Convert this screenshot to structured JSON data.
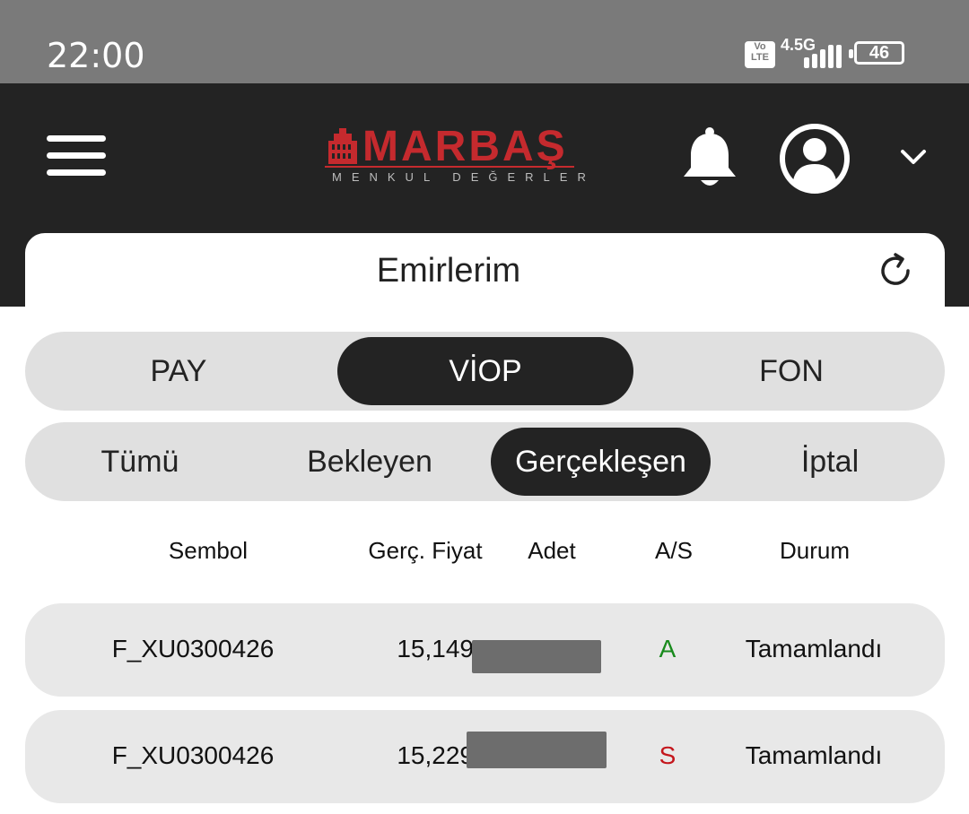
{
  "status_bar": {
    "time": "22:00",
    "volte": [
      "Vo",
      "LTE"
    ],
    "network": "4.5G",
    "battery": "46"
  },
  "header": {
    "logo_text": "MARBAŞ",
    "logo_subtitle": "MENKUL DEĞERLER"
  },
  "page": {
    "title": "Emirlerim"
  },
  "market_tabs": [
    {
      "label": "PAY",
      "active": false
    },
    {
      "label": "VİOP",
      "active": true
    },
    {
      "label": "FON",
      "active": false
    }
  ],
  "status_tabs": [
    {
      "label": "Tümü",
      "active": false
    },
    {
      "label": "Bekleyen",
      "active": false
    },
    {
      "label": "Gerçekleşen",
      "active": true
    },
    {
      "label": "İptal",
      "active": false
    }
  ],
  "table": {
    "columns": [
      "Sembol",
      "Gerç. Fiyat",
      "Adet",
      "A/S",
      "Durum"
    ],
    "rows": [
      {
        "symbol": "F_XU0300426",
        "price": "15,149",
        "side": "A",
        "status": "Tamamlandı"
      },
      {
        "symbol": "F_XU0300426",
        "price": "15,229",
        "side": "S",
        "status": "Tamamlandı"
      }
    ]
  },
  "colors": {
    "header_bg": "#232323",
    "brand_red": "#c52a2e",
    "buy_green": "#188a1c",
    "sell_red": "#c4161c",
    "segment_bg": "#e0e0e0"
  }
}
